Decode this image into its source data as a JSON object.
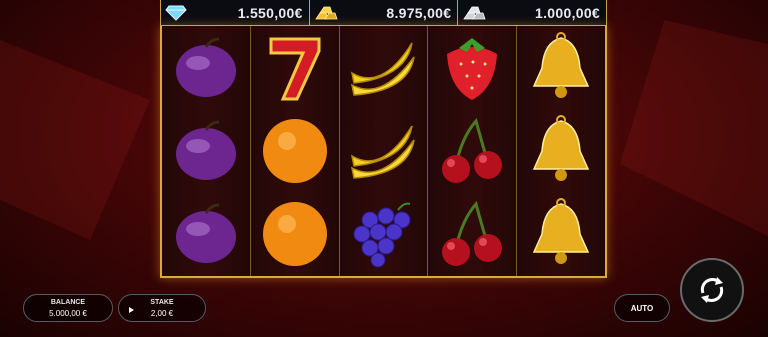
{
  "jackpots": [
    {
      "icon": "diamond-icon",
      "value": "1.550,00€"
    },
    {
      "icon": "gold-bars-icon",
      "value": "8.975,00€"
    },
    {
      "icon": "silver-bars-icon",
      "value": "1.000,00€"
    }
  ],
  "reels": [
    [
      "plum",
      "plum",
      "plum"
    ],
    [
      "seven",
      "orange",
      "orange"
    ],
    [
      "banana",
      "banana",
      "grapes"
    ],
    [
      "strawberry",
      "cherries",
      "cherries"
    ],
    [
      "bell",
      "bell",
      "bell"
    ]
  ],
  "balance": {
    "label": "BALANCE",
    "value": "5.000,00 €"
  },
  "stake": {
    "label": "STAKE",
    "value": "2,00 €"
  },
  "auto": {
    "label": "AUTO"
  },
  "colors": {
    "frame": "#d9a93a",
    "background": "#4a0607",
    "plum": "#7a2a9a",
    "orange": "#f08a10"
  }
}
